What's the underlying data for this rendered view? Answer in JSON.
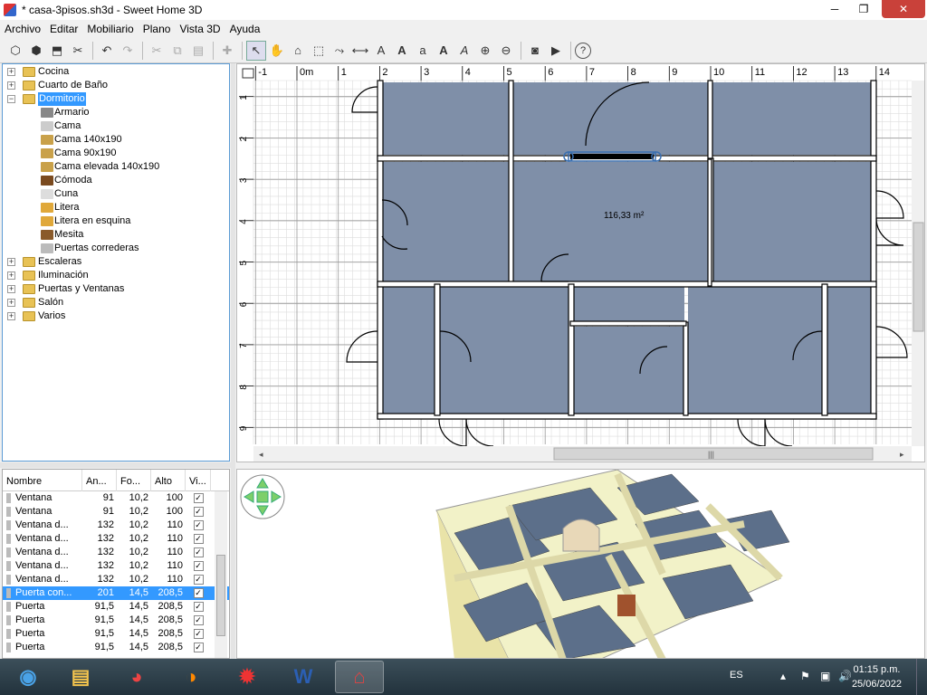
{
  "window": {
    "title": "* casa-3pisos.sh3d - Sweet Home 3D",
    "min_glyph": "─",
    "max_glyph": "❐",
    "close_glyph": "✕"
  },
  "menu": [
    "Archivo",
    "Editar",
    "Mobiliario",
    "Plano",
    "Vista 3D",
    "Ayuda"
  ],
  "toolbar_icons": [
    "new-home-icon",
    "new-home-template-icon",
    "open-icon",
    "cut-furniture-icon",
    "sep",
    "undo-icon",
    "redo-icon",
    "sep",
    "cut-icon",
    "copy-icon",
    "paste-icon",
    "sep",
    "add-furniture-icon",
    "sep",
    "select-mode-icon",
    "pan-mode-icon",
    "create-walls-icon",
    "create-rooms-icon",
    "create-polylines-icon",
    "create-dimensions-icon",
    "add-text-icon",
    "increase-text-icon",
    "decrease-text-icon",
    "bold-icon",
    "italic-icon",
    "zoom-in-icon",
    "zoom-out-icon",
    "sep",
    "create-photo-icon",
    "create-video-icon",
    "sep",
    "help-icon"
  ],
  "catalog": {
    "categories_top": [
      {
        "label": "Cocina",
        "expanded": false
      },
      {
        "label": "Cuarto de Baño",
        "expanded": false
      },
      {
        "label": "Dormitorio",
        "expanded": true,
        "selected": true
      }
    ],
    "dormitorio_items": [
      "Armario",
      "Cama",
      "Cama 140x190",
      "Cama 90x190",
      "Cama elevada 140x190",
      "Cómoda",
      "Cuna",
      "Litera",
      "Litera en esquina",
      "Mesita",
      "Puertas correderas"
    ],
    "categories_bottom": [
      "Escaleras",
      "Iluminación",
      "Puertas y Ventanas",
      "Salón",
      "Varios"
    ]
  },
  "furniture_table": {
    "columns": [
      "Nombre",
      "An...",
      "Fo...",
      "Alto",
      "Vi..."
    ],
    "rows": [
      {
        "name": "Ventana",
        "w": "91",
        "d": "10,2",
        "h": "100",
        "visible": true,
        "selected": false
      },
      {
        "name": "Ventana",
        "w": "91",
        "d": "10,2",
        "h": "100",
        "visible": true,
        "selected": false
      },
      {
        "name": "Ventana d...",
        "w": "132",
        "d": "10,2",
        "h": "110",
        "visible": true,
        "selected": false
      },
      {
        "name": "Ventana d...",
        "w": "132",
        "d": "10,2",
        "h": "110",
        "visible": true,
        "selected": false
      },
      {
        "name": "Ventana d...",
        "w": "132",
        "d": "10,2",
        "h": "110",
        "visible": true,
        "selected": false
      },
      {
        "name": "Ventana d...",
        "w": "132",
        "d": "10,2",
        "h": "110",
        "visible": true,
        "selected": false
      },
      {
        "name": "Ventana d...",
        "w": "132",
        "d": "10,2",
        "h": "110",
        "visible": true,
        "selected": false
      },
      {
        "name": "Puerta con...",
        "w": "201",
        "d": "14,5",
        "h": "208,5",
        "visible": true,
        "selected": true
      },
      {
        "name": "Puerta",
        "w": "91,5",
        "d": "14,5",
        "h": "208,5",
        "visible": true,
        "selected": false
      },
      {
        "name": "Puerta",
        "w": "91,5",
        "d": "14,5",
        "h": "208,5",
        "visible": true,
        "selected": false
      },
      {
        "name": "Puerta",
        "w": "91,5",
        "d": "14,5",
        "h": "208,5",
        "visible": true,
        "selected": false
      },
      {
        "name": "Puerta",
        "w": "91,5",
        "d": "14,5",
        "h": "208,5",
        "visible": true,
        "selected": false
      }
    ]
  },
  "plan": {
    "ruler_x_labels": [
      "-1",
      "0m",
      "1",
      "2",
      "3",
      "4",
      "5",
      "6",
      "7",
      "8",
      "9",
      "10",
      "11",
      "12",
      "13",
      "14"
    ],
    "ruler_y_labels": [
      "1",
      "2",
      "3",
      "4",
      "5",
      "6",
      "7",
      "8",
      "9"
    ],
    "room_area_label": "116,33 m²",
    "floor_color": "#7f8fa8",
    "hscroll_glyph": "|||"
  },
  "taskbar": {
    "apps": [
      "start-orb-icon",
      "file-explorer-icon",
      "chrome-icon",
      "firefox-icon",
      "game-app-icon",
      "word-icon",
      "sweet-home-3d-icon"
    ],
    "language": "ES",
    "time": "01:15 p.m.",
    "date": "25/06/2022"
  }
}
